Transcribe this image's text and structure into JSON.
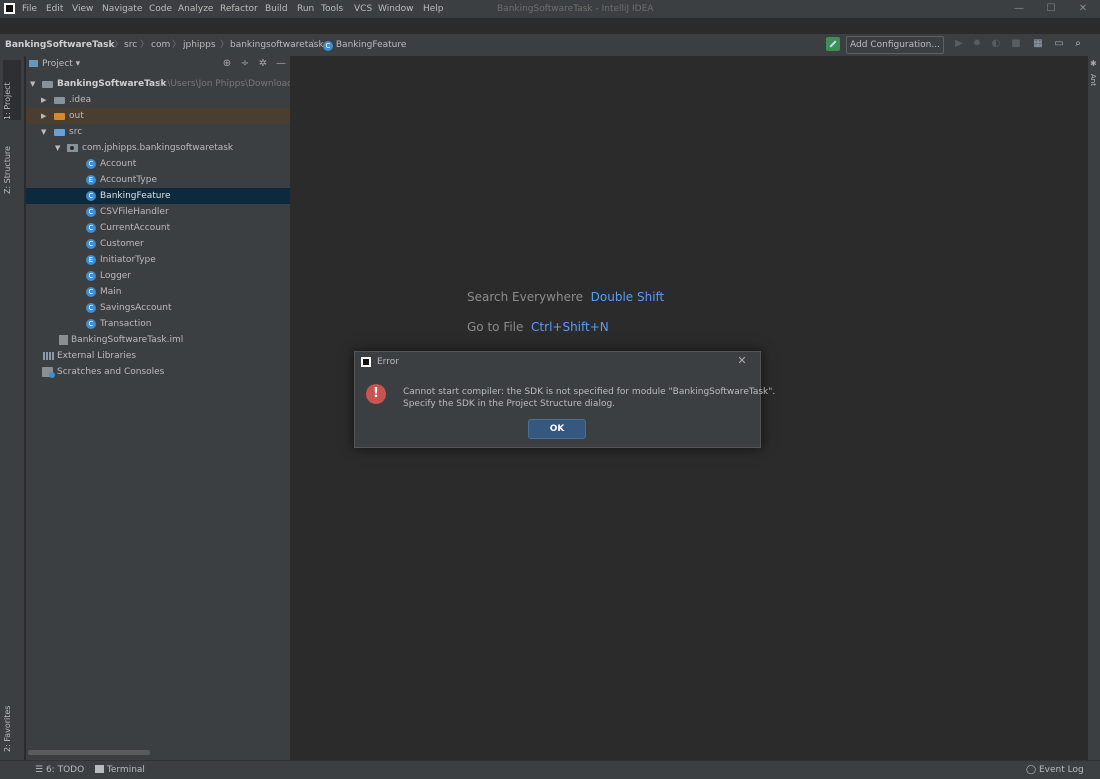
{
  "menubar": {
    "items": [
      "File",
      "Edit",
      "View",
      "Navigate",
      "Code",
      "Analyze",
      "Refactor",
      "Build",
      "Run",
      "Tools",
      "VCS",
      "Window",
      "Help"
    ],
    "window_title": "BankingSoftwareTask - IntelliJ IDEA"
  },
  "breadcrumbs": [
    "BankingSoftwareTask",
    "src",
    "com",
    "jphipps",
    "bankingsoftwaretask",
    "BankingFeature"
  ],
  "toolbar": {
    "add_configuration": "Add Configuration..."
  },
  "left_strip": {
    "tabs": [
      "1: Project",
      "Z: Structure",
      "2: Favorites"
    ]
  },
  "project_panel": {
    "title": "Project",
    "tree": [
      {
        "label": "BankingSoftwareTask",
        "path": "C:\\Users\\Jon Phipps\\Downloads",
        "type": "module"
      },
      {
        "label": ".idea",
        "type": "folder"
      },
      {
        "label": "out",
        "type": "folder-orange"
      },
      {
        "label": "src",
        "type": "folder-blue"
      },
      {
        "label": "com.jphipps.bankingsoftwaretask",
        "type": "package"
      },
      {
        "label": "Account",
        "type": "class"
      },
      {
        "label": "AccountType",
        "type": "class"
      },
      {
        "label": "BankingFeature",
        "type": "class",
        "selected": true
      },
      {
        "label": "CSVFileHandler",
        "type": "class"
      },
      {
        "label": "CurrentAccount",
        "type": "class"
      },
      {
        "label": "Customer",
        "type": "class"
      },
      {
        "label": "InitiatorType",
        "type": "class"
      },
      {
        "label": "Logger",
        "type": "class"
      },
      {
        "label": "Main",
        "type": "class"
      },
      {
        "label": "SavingsAccount",
        "type": "class"
      },
      {
        "label": "Transaction",
        "type": "class"
      },
      {
        "label": "BankingSoftwareTask.iml",
        "type": "iml"
      },
      {
        "label": "External Libraries",
        "type": "libraries"
      },
      {
        "label": "Scratches and Consoles",
        "type": "scratches"
      }
    ]
  },
  "editor": {
    "hints": [
      {
        "label": "Search Everywhere",
        "shortcut": "Double Shift"
      },
      {
        "label": "Go to File",
        "shortcut": "Ctrl+Shift+N"
      }
    ]
  },
  "right_strip": {
    "tab": "Ant"
  },
  "statusbar": {
    "todo": "6: TODO",
    "terminal": "Terminal",
    "event_log": "Event Log"
  },
  "dialog": {
    "title": "Error",
    "message_line1": "Cannot start compiler: the SDK is not specified for module \"BankingSoftwareTask\".",
    "message_line2": "Specify the SDK in the Project Structure dialog.",
    "ok": "OK"
  },
  "colors": {
    "accent": "#589df6",
    "selection": "#0d293e",
    "error": "#c75450",
    "button": "#365880"
  }
}
